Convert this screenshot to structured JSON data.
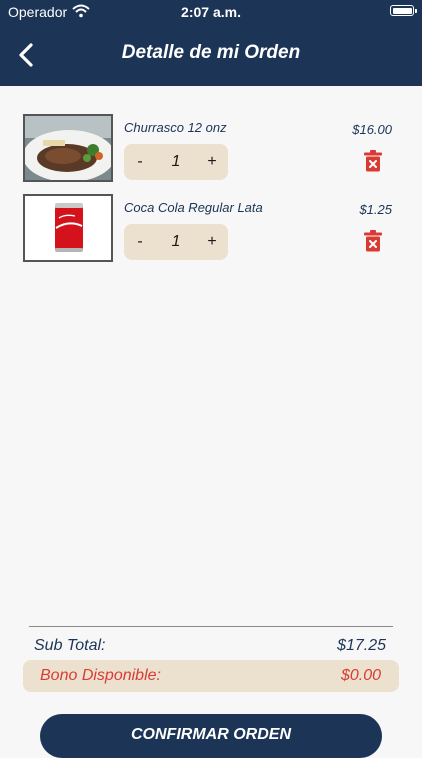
{
  "status_bar": {
    "carrier": "Operador",
    "time": "2:07 a.m."
  },
  "header": {
    "title": "Detalle de mi Orden",
    "back_icon": "chevron-left-icon"
  },
  "order": {
    "items": [
      {
        "name": "Churrasco 12 onz",
        "price": "$16.00",
        "quantity": "1",
        "decrement": "-",
        "increment": "+",
        "image": "steak-plate-image"
      },
      {
        "name": "Coca Cola Regular Lata",
        "price": "$1.25",
        "quantity": "1",
        "decrement": "-",
        "increment": "+",
        "image": "coca-cola-can-image"
      }
    ]
  },
  "summary": {
    "subtotal_label": "Sub Total:",
    "subtotal_value": "$17.25",
    "bono_label": "Bono Disponible:",
    "bono_value": "$0.00"
  },
  "actions": {
    "confirm_label": "CONFIRMAR ORDEN"
  },
  "colors": {
    "primary": "#1c3557",
    "accent_bg": "#ece1cf",
    "danger": "#d93b34"
  }
}
